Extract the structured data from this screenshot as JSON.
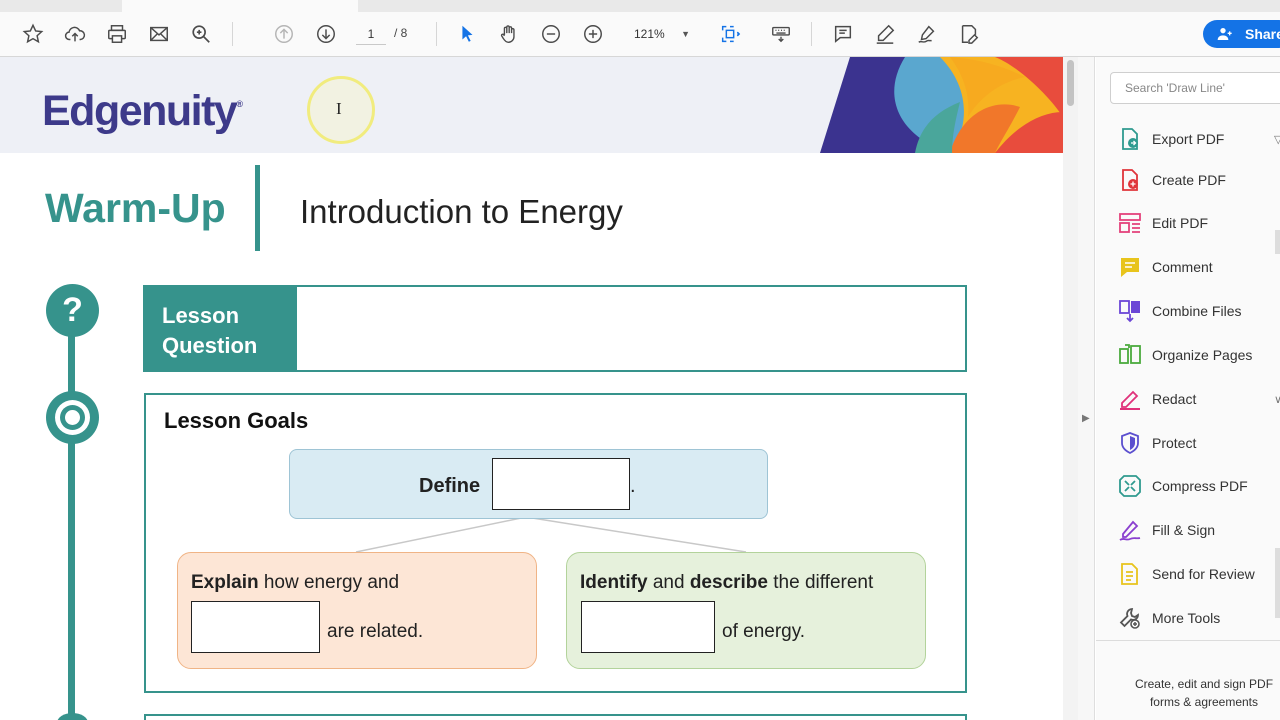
{
  "toolbar": {
    "page_current": "1",
    "page_total": "/ 8",
    "zoom": "121%",
    "share_label": "Share",
    "icons": [
      "star-icon",
      "cloud-upload-icon",
      "print-icon",
      "mail-icon",
      "search-icon",
      "page-up-icon",
      "page-down-icon",
      "select-arrow-icon",
      "hand-icon",
      "zoom-out-icon",
      "zoom-in-icon",
      "fit-page-icon",
      "keyboard-icon",
      "comment-icon",
      "highlight-pen-icon",
      "sign-icon",
      "fill-form-icon"
    ]
  },
  "doc": {
    "logo": "Edgenuity",
    "logo_mark": "®",
    "warmup": "Warm-Up",
    "title": "Introduction to Energy",
    "question_mark": "?",
    "lesson_question_label": "Lesson Question",
    "lesson_goals_title": "Lesson Goals",
    "define_label": "Define",
    "define_after": ".",
    "explain_bold": "Explain",
    "explain_rest": " how energy and",
    "explain_after": "are related.",
    "identify_bold": "Identify",
    "identify_mid": " and ",
    "describe_bold": "describe",
    "identify_rest": " the different",
    "identify_after": "of energy."
  },
  "rightpane": {
    "search_placeholder": "Search 'Draw Line'",
    "tools": [
      {
        "label": "Export PDF",
        "icon": "export-pdf-icon",
        "color": "#2f9a8f"
      },
      {
        "label": "Create PDF",
        "icon": "create-pdf-icon",
        "color": "#e0353b"
      },
      {
        "label": "Edit PDF",
        "icon": "edit-pdf-icon",
        "color": "#e4417b"
      },
      {
        "label": "Comment",
        "icon": "comment-icon",
        "color": "#e8c41c"
      },
      {
        "label": "Combine Files",
        "icon": "combine-files-icon",
        "color": "#6b46d6"
      },
      {
        "label": "Organize Pages",
        "icon": "organize-pages-icon",
        "color": "#4bab3d"
      },
      {
        "label": "Redact",
        "icon": "redact-icon",
        "color": "#e0327b"
      },
      {
        "label": "Protect",
        "icon": "protect-icon",
        "color": "#5b4fcf"
      },
      {
        "label": "Compress PDF",
        "icon": "compress-pdf-icon",
        "color": "#2f9a8f"
      },
      {
        "label": "Fill & Sign",
        "icon": "fill-sign-icon",
        "color": "#8a3fcf"
      },
      {
        "label": "Send for Review",
        "icon": "send-review-icon",
        "color": "#e8c41c"
      },
      {
        "label": "More Tools",
        "icon": "more-tools-icon",
        "color": "#555555"
      }
    ],
    "footer": "Create, edit and sign PDF forms & agreements"
  },
  "colors": {
    "teal": "#36938c",
    "brand_purple": "#3d3a8a",
    "share_blue": "#1473e6"
  }
}
